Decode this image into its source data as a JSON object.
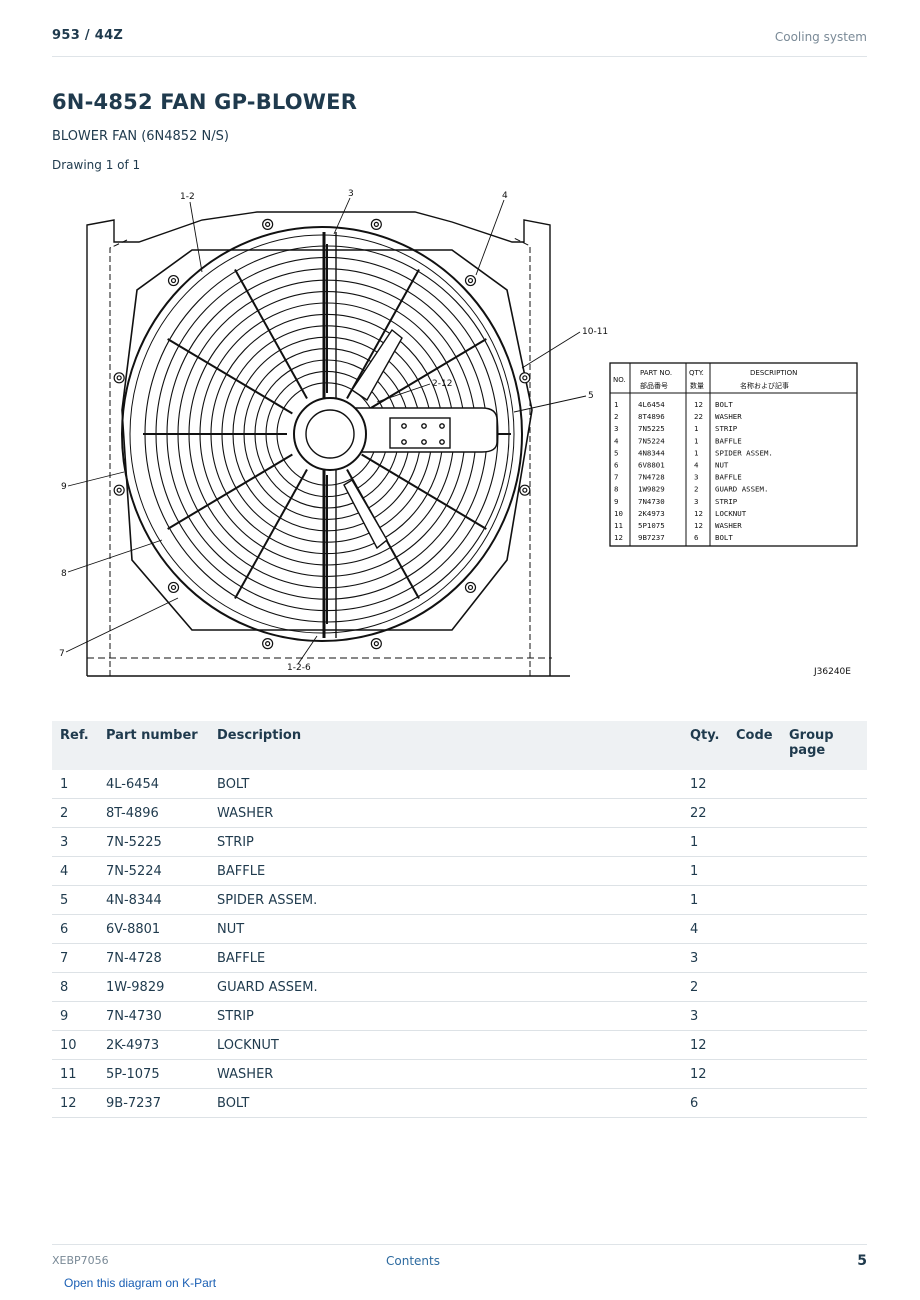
{
  "header": {
    "model": "953  /  44Z",
    "section": "Cooling system"
  },
  "title": "6N-4852 FAN GP-BLOWER",
  "subtitle": "BLOWER FAN (6N4852 N/S)",
  "drawing_count": "Drawing 1 of 1",
  "drawing": {
    "callouts": [
      "1-2",
      "3",
      "4",
      "10-11",
      "2-12",
      "5",
      "9",
      "8",
      "7",
      "1-2-6"
    ],
    "drawing_number": "J36240E",
    "legend": {
      "headers": {
        "no": "NO.",
        "part_no": "PART NO.",
        "part_no_jp": "部品番号",
        "qty": "QTY.",
        "qty_jp": "数量",
        "description": "DESCRIPTION",
        "description_jp": "名称および記事"
      },
      "rows": [
        {
          "no": "1",
          "part": "4L6454",
          "qty": "12",
          "desc": "BOLT"
        },
        {
          "no": "2",
          "part": "8T4896",
          "qty": "22",
          "desc": "WASHER"
        },
        {
          "no": "3",
          "part": "7N5225",
          "qty": "1",
          "desc": "STRIP"
        },
        {
          "no": "4",
          "part": "7N5224",
          "qty": "1",
          "desc": "BAFFLE"
        },
        {
          "no": "5",
          "part": "4N8344",
          "qty": "1",
          "desc": "SPIDER ASSEM."
        },
        {
          "no": "6",
          "part": "6V8801",
          "qty": "4",
          "desc": "NUT"
        },
        {
          "no": "7",
          "part": "7N4728",
          "qty": "3",
          "desc": "BAFFLE"
        },
        {
          "no": "8",
          "part": "1W9829",
          "qty": "2",
          "desc": "GUARD ASSEM."
        },
        {
          "no": "9",
          "part": "7N4730",
          "qty": "3",
          "desc": "STRIP"
        },
        {
          "no": "10",
          "part": "2K4973",
          "qty": "12",
          "desc": "LOCKNUT"
        },
        {
          "no": "11",
          "part": "5P1075",
          "qty": "12",
          "desc": "WASHER"
        },
        {
          "no": "12",
          "part": "9B7237",
          "qty": "6",
          "desc": "BOLT"
        }
      ]
    }
  },
  "table": {
    "headers": {
      "ref": "Ref.",
      "part_number": "Part number",
      "description": "Description",
      "qty": "Qty.",
      "code": "Code",
      "group_page": "Group page"
    },
    "rows": [
      {
        "ref": "1",
        "part": "4L-6454",
        "desc": "BOLT",
        "qty": "12",
        "code": "",
        "group": ""
      },
      {
        "ref": "2",
        "part": "8T-4896",
        "desc": "WASHER",
        "qty": "22",
        "code": "",
        "group": ""
      },
      {
        "ref": "3",
        "part": "7N-5225",
        "desc": "STRIP",
        "qty": "1",
        "code": "",
        "group": ""
      },
      {
        "ref": "4",
        "part": "7N-5224",
        "desc": "BAFFLE",
        "qty": "1",
        "code": "",
        "group": ""
      },
      {
        "ref": "5",
        "part": "4N-8344",
        "desc": "SPIDER ASSEM.",
        "qty": "1",
        "code": "",
        "group": ""
      },
      {
        "ref": "6",
        "part": "6V-8801",
        "desc": "NUT",
        "qty": "4",
        "code": "",
        "group": ""
      },
      {
        "ref": "7",
        "part": "7N-4728",
        "desc": "BAFFLE",
        "qty": "3",
        "code": "",
        "group": ""
      },
      {
        "ref": "8",
        "part": "1W-9829",
        "desc": "GUARD ASSEM.",
        "qty": "2",
        "code": "",
        "group": ""
      },
      {
        "ref": "9",
        "part": "7N-4730",
        "desc": "STRIP",
        "qty": "3",
        "code": "",
        "group": ""
      },
      {
        "ref": "10",
        "part": "2K-4973",
        "desc": "LOCKNUT",
        "qty": "12",
        "code": "",
        "group": ""
      },
      {
        "ref": "11",
        "part": "5P-1075",
        "desc": "WASHER",
        "qty": "12",
        "code": "",
        "group": ""
      },
      {
        "ref": "12",
        "part": "9B-7237",
        "desc": "BOLT",
        "qty": "6",
        "code": "",
        "group": ""
      }
    ]
  },
  "footer": {
    "doc_id": "XEBP7056",
    "contents_link": "Contents",
    "page_number": "5"
  },
  "kpart_link": "Open this diagram on K-Part"
}
